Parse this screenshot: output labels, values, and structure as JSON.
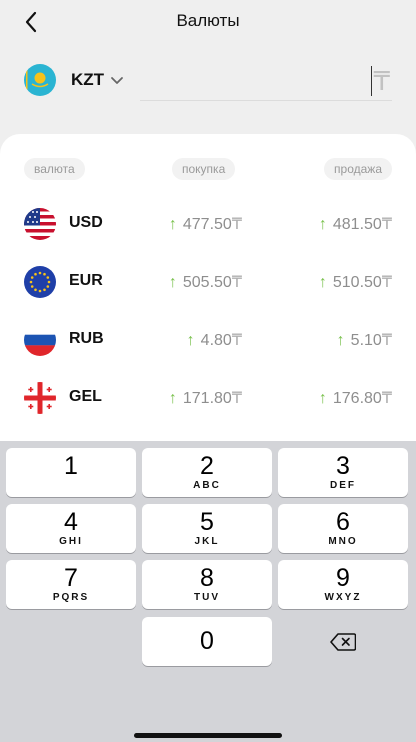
{
  "header": {
    "title": "Валюты"
  },
  "converter": {
    "base_code": "KZT",
    "amount_placeholder": "₸"
  },
  "table": {
    "headers": {
      "currency": "валюта",
      "buy": "покупка",
      "sell": "продажа"
    },
    "rows": [
      {
        "code": "USD",
        "buy": "477.50",
        "sell": "481.50",
        "flag": "us-flag-icon"
      },
      {
        "code": "EUR",
        "buy": "505.50",
        "sell": "510.50",
        "flag": "eu-flag-icon"
      },
      {
        "code": "RUB",
        "buy": "4.80",
        "sell": "5.10",
        "flag": "ru-flag-icon"
      },
      {
        "code": "GEL",
        "buy": "171.80",
        "sell": "176.80",
        "flag": "ge-flag-icon"
      }
    ],
    "currency_suffix": "₸",
    "trend_arrow": "↑"
  },
  "keyboard": {
    "keys": [
      {
        "digit": "1",
        "letters": ""
      },
      {
        "digit": "2",
        "letters": "ABC"
      },
      {
        "digit": "3",
        "letters": "DEF"
      },
      {
        "digit": "4",
        "letters": "GHI"
      },
      {
        "digit": "5",
        "letters": "JKL"
      },
      {
        "digit": "6",
        "letters": "MNO"
      },
      {
        "digit": "7",
        "letters": "PQRS"
      },
      {
        "digit": "8",
        "letters": "TUV"
      },
      {
        "digit": "9",
        "letters": "WXYZ"
      },
      {
        "digit": "0",
        "letters": ""
      }
    ]
  },
  "colors": {
    "up": "#7bc24f",
    "accent_gray": "#9a9a9a",
    "keyboard_bg": "#d3d4d8"
  }
}
